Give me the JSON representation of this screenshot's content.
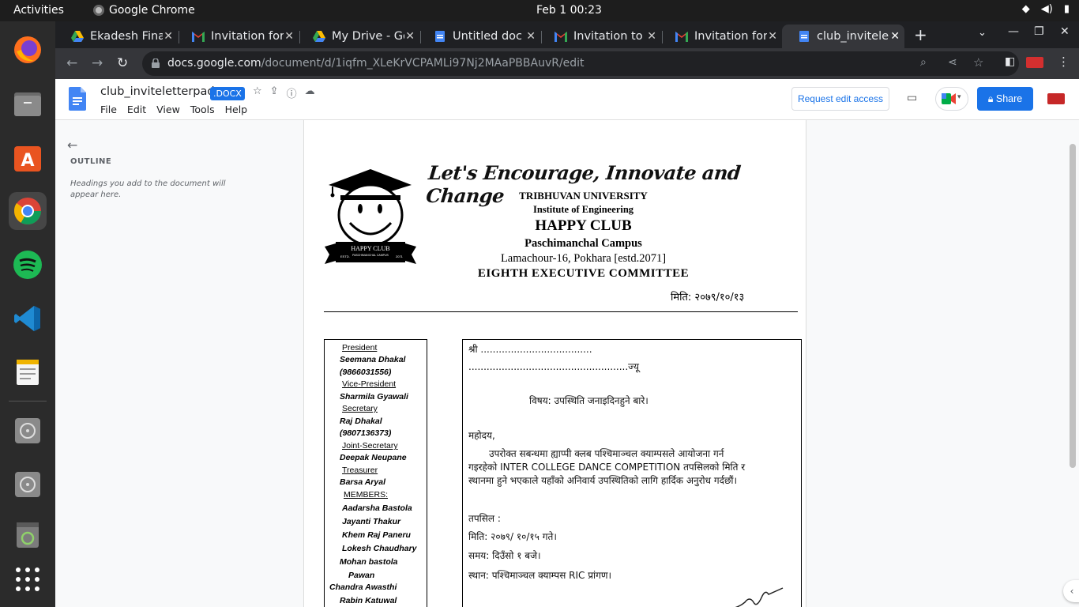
{
  "topbar": {
    "activities": "Activities",
    "app_name": "Google Chrome",
    "clock": "Feb 1  00:23"
  },
  "tabs": [
    {
      "label": "Ekadesh Fina",
      "icon": "google-drive-icon"
    },
    {
      "label": "Invitation for",
      "icon": "gmail-icon"
    },
    {
      "label": "My Drive - Go",
      "icon": "google-drive-icon"
    },
    {
      "label": "Untitled doc",
      "icon": "google-docs-icon"
    },
    {
      "label": "Invitation to",
      "icon": "gmail-icon"
    },
    {
      "label": "Invitation for",
      "icon": "gmail-icon"
    },
    {
      "label": "club_invitele",
      "icon": "google-docs-icon",
      "active": true
    }
  ],
  "address": {
    "domain": "docs.google.com",
    "path": "/document/d/1iqfm_XLeKrVCPAMLi97Nj2MAaPBBAuvR/edit"
  },
  "doc": {
    "title": "club_inviteletterpad",
    "badge": ".DOCX",
    "menu": [
      "File",
      "Edit",
      "View",
      "Tools",
      "Help"
    ],
    "request_edit": "Request edit access",
    "share": "Share"
  },
  "outline": {
    "title": "OUTLINE",
    "hint": "Headings you add to the document will appear here."
  },
  "letterhead": {
    "slogan": "Let's Encourage, Innovate and Change",
    "university": "TRIBHUVAN UNIVERSITY",
    "institute": "Institute of Engineering",
    "club": "HAPPY CLUB",
    "campus": "Paschimanchal Campus",
    "address": "Lamachour-16, Pokhara [estd.2071]",
    "committee": "EIGHTH  EXECUTIVE COMMITTEE",
    "date": "मिति: २०७९/१०/१३",
    "logo_banner": "HAPPY CLUB",
    "logo_sub": "PASCHIMANCHAL CAMPUS",
    "logo_left": "ESTD.",
    "logo_right": "2071"
  },
  "members": {
    "president_role": "President",
    "president_name": "Seemana Dhakal",
    "president_phone": "(9866031556)",
    "vp_role": "Vice-President",
    "vp_name": "Sharmila Gyawali",
    "secretary_role": "Secretary",
    "secretary_name": "Raj Dhakal",
    "secretary_phone": "(9807136373)",
    "joint_role": "Joint-Secretary",
    "joint_name": "Deepak Neupane",
    "treasurer_role": "Treasurer",
    "treasurer_name": "Barsa Aryal",
    "members_role": "MEMBERS:",
    "m1": "Aadarsha Bastola",
    "m2": "Jayanti Thakur",
    "m3": "Khem Raj Paneru",
    "m4": "Lokesh Chaudhary",
    "m5": "Mohan bastola",
    "m6": "Pawan",
    "m7": "Chandra Awasthi",
    "m8": "Rabin Katuwal"
  },
  "letter": {
    "shree": "श्री   .....................................",
    "ji": ".....................................................ज्यू",
    "subject": "विषय: उपस्थिति जनाइदिनहुने बारे।",
    "greeting": "महोदय,",
    "body1": "उपरोक्त सबन्धमा ह्याप्पी क्लब पश्चिमाञ्चल क्याम्पसले आयोजना गर्न",
    "body2": "गइरहेको INTER COLLEGE DANCE COMPETITION  तपसिलको मिति र",
    "body3": "स्थानमा हुने भएकाले यहाँको अनिवार्य उपस्थितिको लागि  हार्दिक अनुरोध गर्दछौं।",
    "details": "तपसिल :",
    "date_line": "मिति: २०७९/ १०/१५ गते।",
    "time_line": "समय:  दिउँसो १ बजे।",
    "venue_line": "स्थान: पश्चिमाञ्चल क्याम्पस RIC प्रांगण।"
  }
}
